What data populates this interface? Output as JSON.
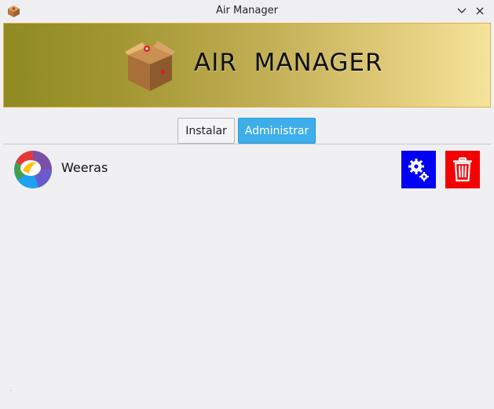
{
  "window": {
    "title": "Air Manager",
    "icons": {
      "app": "box-icon",
      "minimize": "chevron-down-icon",
      "close": "close-icon"
    }
  },
  "banner": {
    "title": "AIR  MANAGER",
    "icon": "package-box-icon"
  },
  "tabs": [
    {
      "label": "Instalar",
      "active": false
    },
    {
      "label": "Administrar",
      "active": true
    }
  ],
  "apps": [
    {
      "name": "Weeras",
      "icon": "weeras-logo-icon",
      "actions": [
        {
          "name": "settings",
          "icon": "gears-icon",
          "color": "#0000f5"
        },
        {
          "name": "delete",
          "icon": "trash-icon",
          "color": "#f50000"
        }
      ]
    }
  ],
  "colors": {
    "active_tab": "#3daee9",
    "banner_start": "#8f8a22",
    "banner_end": "#f4e39a"
  }
}
